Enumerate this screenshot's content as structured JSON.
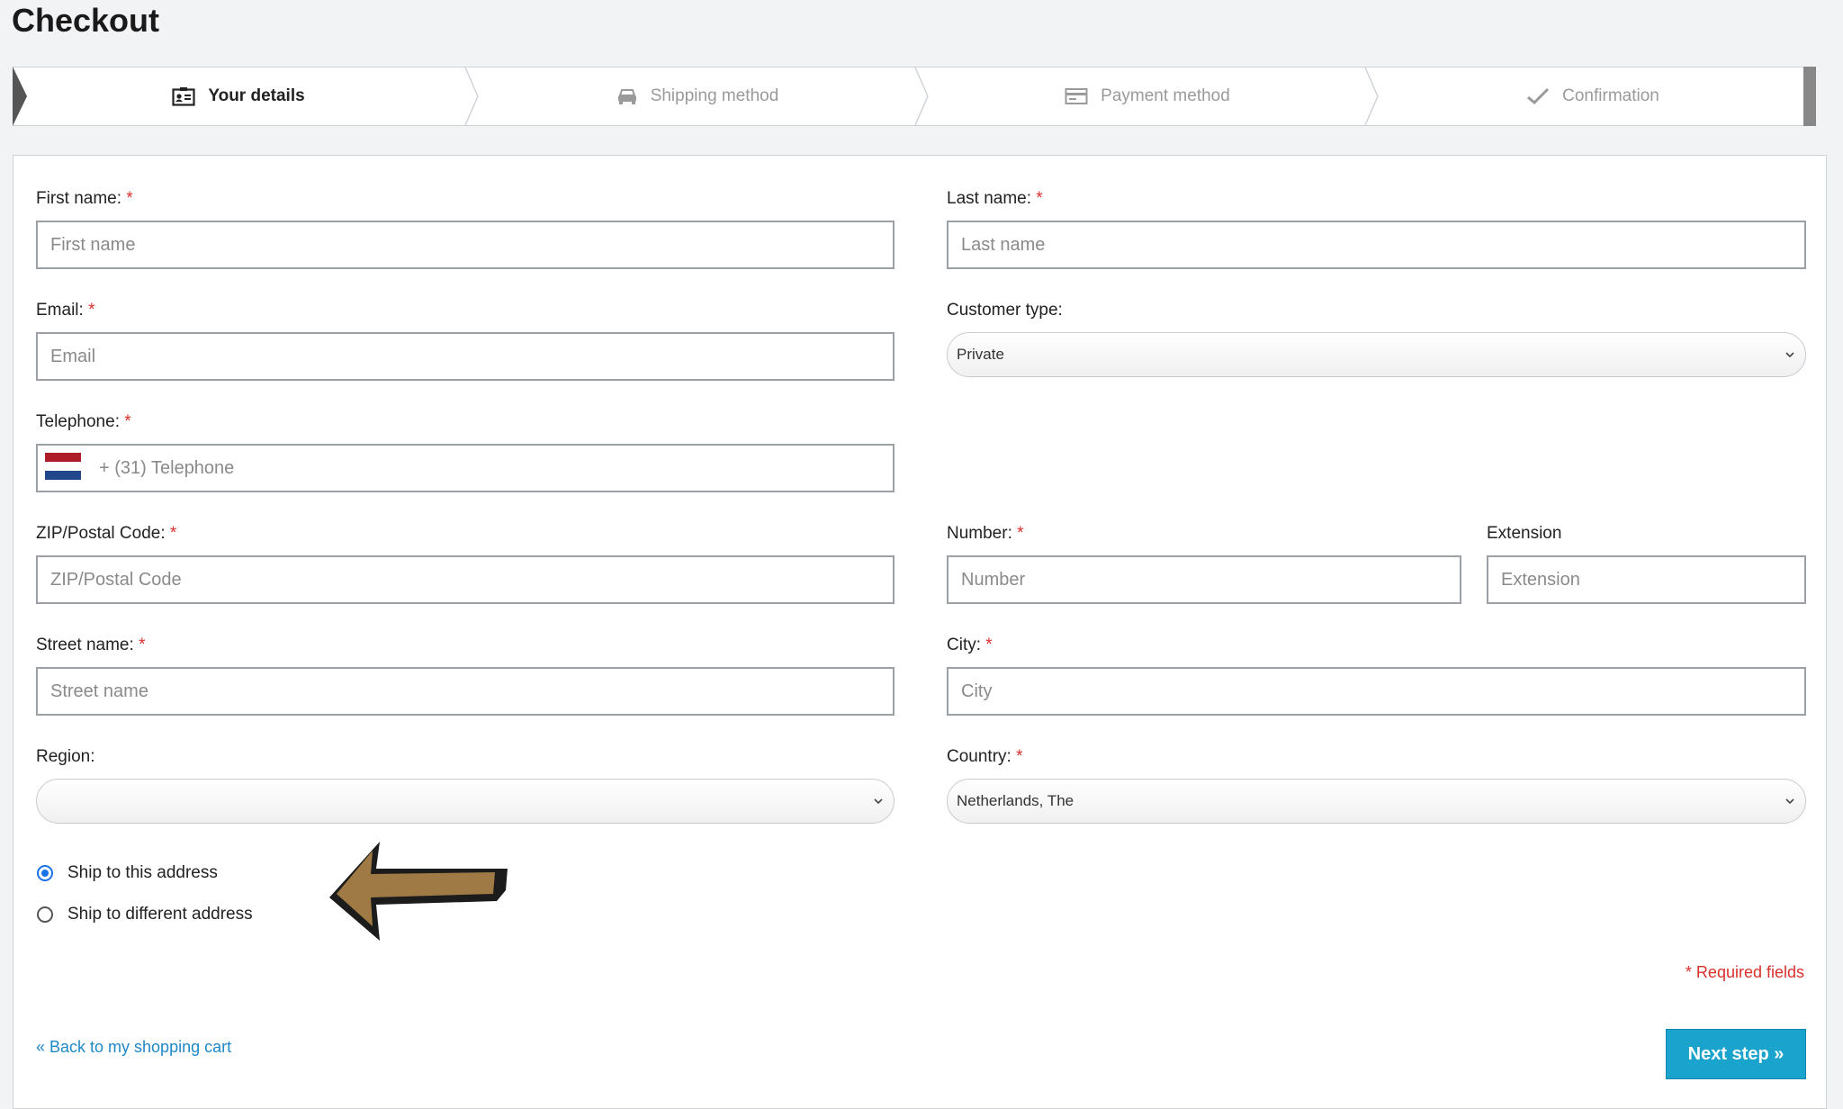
{
  "page": {
    "title": "Checkout"
  },
  "steps": [
    {
      "label": "Your details",
      "icon": "id-card-icon",
      "active": true
    },
    {
      "label": "Shipping method",
      "icon": "car-icon",
      "active": false
    },
    {
      "label": "Payment method",
      "icon": "credit-card-icon",
      "active": false
    },
    {
      "label": "Confirmation",
      "icon": "checkmark-icon",
      "active": false
    }
  ],
  "form": {
    "required_mark": "*",
    "first_name": {
      "label": "First name:",
      "placeholder": "First name",
      "value": ""
    },
    "last_name": {
      "label": "Last name:",
      "placeholder": "Last name",
      "value": ""
    },
    "email": {
      "label": "Email:",
      "placeholder": "Email",
      "value": ""
    },
    "customer_type": {
      "label": "Customer type:",
      "selected": "Private"
    },
    "telephone": {
      "label": "Telephone:",
      "placeholder": "+ (31) Telephone",
      "flag_colors": [
        "#ae1c28",
        "#ffffff",
        "#21468b"
      ]
    },
    "zip": {
      "label": "ZIP/Postal Code:",
      "placeholder": "ZIP/Postal Code"
    },
    "number": {
      "label": "Number:",
      "placeholder": "Number"
    },
    "extension": {
      "label": "Extension",
      "placeholder": "Extension"
    },
    "street": {
      "label": "Street name:",
      "placeholder": "Street name"
    },
    "city": {
      "label": "City:",
      "placeholder": "City"
    },
    "region": {
      "label": "Region:",
      "selected": ""
    },
    "country": {
      "label": "Country:",
      "selected": "Netherlands, The"
    },
    "shipping_options": [
      {
        "label": "Ship to this address",
        "checked": true
      },
      {
        "label": "Ship to different address",
        "checked": false
      }
    ],
    "required_note": "* Required fields"
  },
  "footer": {
    "back_link": "« Back to my shopping cart",
    "next_button": "Next step »"
  },
  "colors": {
    "accent": "#1aa3cc",
    "required": "#d9302c",
    "link": "#1f88c7",
    "arrow_fill": "#a07a45"
  }
}
